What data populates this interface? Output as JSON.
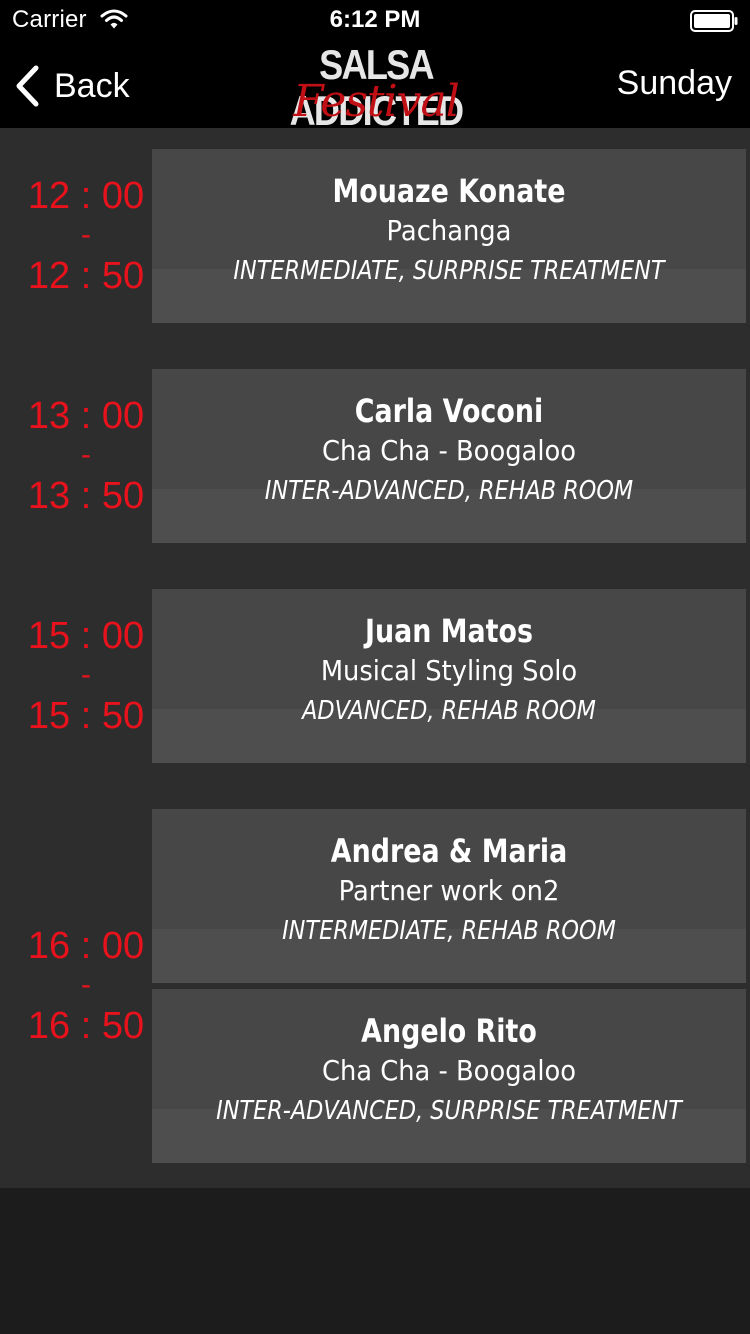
{
  "status": {
    "carrier": "Carrier",
    "time": "6:12 PM"
  },
  "nav": {
    "back_label": "Back",
    "day": "Sunday"
  },
  "logo": {
    "main": "SALSA ADDICTED",
    "script": "Festival"
  },
  "colors": {
    "accent": "#e8121c",
    "header_bg": "#000000",
    "content_bg": "#2d2d2d",
    "card_bg": "#474747",
    "page_bg": "#1c1c1c"
  },
  "slots": [
    {
      "start": "12 : 00",
      "sep": "-",
      "end": "12 : 50"
    },
    {
      "start": "13 : 00",
      "sep": "-",
      "end": "13 : 50"
    },
    {
      "start": "15 : 00",
      "sep": "-",
      "end": "15 : 50"
    },
    {
      "start": "16 : 00",
      "sep": "-",
      "end": "16 : 50"
    }
  ],
  "sessions": [
    {
      "teacher": "Mouaze Konate",
      "class": "Pachanga",
      "meta": "INTERMEDIATE, SURPRISE TREATMENT"
    },
    {
      "teacher": "Carla Voconi",
      "class": "Cha Cha - Boogaloo",
      "meta": "INTER-ADVANCED, REHAB ROOM"
    },
    {
      "teacher": "Juan Matos",
      "class": "Musical Styling Solo",
      "meta": "ADVANCED, REHAB ROOM"
    },
    {
      "teacher": "Andrea & Maria",
      "class": "Partner work on2",
      "meta": "INTERMEDIATE, REHAB ROOM"
    },
    {
      "teacher": "Angelo Rito",
      "class": "Cha Cha - Boogaloo",
      "meta": "INTER-ADVANCED, SURPRISE TREATMENT"
    }
  ],
  "icons": {
    "back": "chevron-left-icon",
    "wifi": "wifi-icon",
    "battery": "battery-icon"
  }
}
